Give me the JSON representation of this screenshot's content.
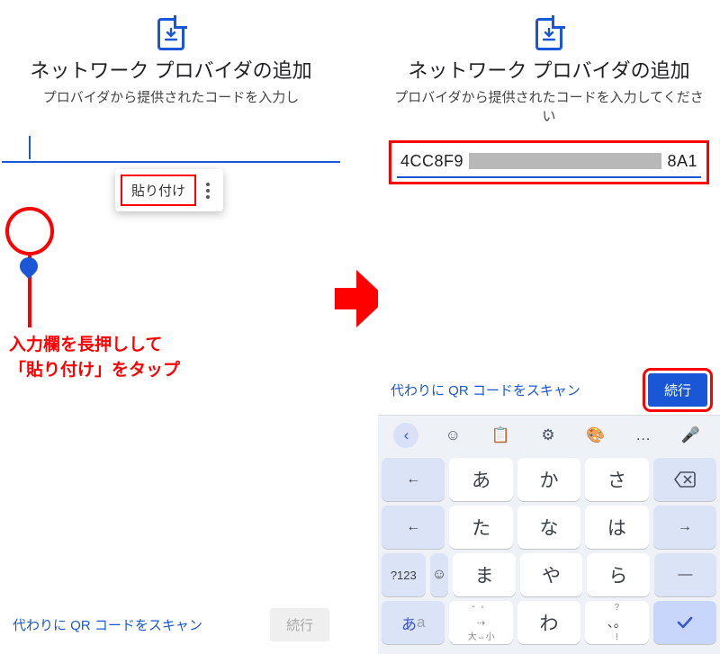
{
  "left": {
    "title": "ネットワーク プロバイダの追加",
    "subtitle": "プロバイダから提供されたコードを入力し",
    "paste_label": "貼り付け",
    "instruction_line1": "入力欄を長押しして",
    "instruction_line2": "「貼り付け」をタップ",
    "qr_link": "代わりに QR コードをスキャン",
    "continue_label": "続行"
  },
  "right": {
    "title": "ネットワーク プロバイダの追加",
    "subtitle": "プロバイダから提供されたコードを入力してください",
    "code_prefix": "4CC8F9",
    "code_suffix": "8A1",
    "qr_link": "代わりに QR コードをスキャン",
    "continue_label": "続行"
  },
  "keyboard": {
    "toolbar_more": "…",
    "rows": [
      {
        "fnL": "←",
        "k1": "あ",
        "k2": "か",
        "k3": "さ",
        "fnR": "⌫"
      },
      {
        "fnL": "←",
        "k1": "た",
        "k2": "な",
        "k3": "は",
        "fnR": "→"
      },
      {
        "fnL": "?123",
        "emoji": "☺",
        "k1": "ま",
        "k2": "や",
        "k3": "ら",
        "fnR": "—"
      },
      {
        "fnL": "あa",
        "k1_top": "゛゜",
        "k1": "⇢",
        "k1_bot": "大⇔小",
        "k2": "わ",
        "k3_top": "?",
        "k3": "、。",
        "k3_bot": "!",
        "ok": "✓"
      }
    ]
  }
}
